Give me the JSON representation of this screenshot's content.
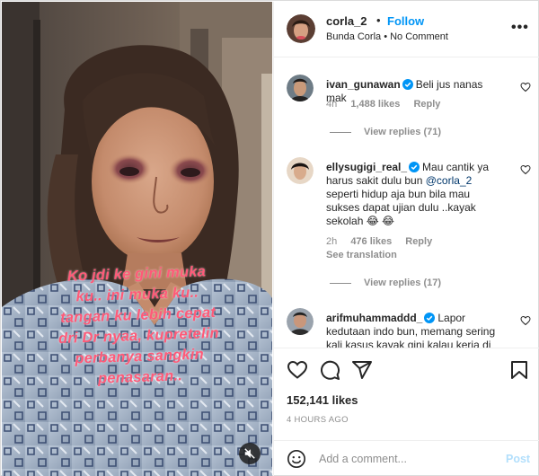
{
  "post": {
    "username": "corla_2",
    "separator": "•",
    "follow_label": "Follow",
    "subtitle": "Bunda Corla • No Comment",
    "more_label": "•••",
    "caption_lines": [
      "Ko jdi ke gini muka",
      "ku.. ini muka ku..",
      "tangan ku lebih cepat",
      "dri Dr nyaa, kupretelin",
      "perbanya sangkin",
      "penasaran.."
    ]
  },
  "comments": [
    {
      "username": "ivan_gunawan",
      "verified": true,
      "text": "Beli jus nanas mak",
      "age": "4h",
      "likes": "1,488 likes",
      "reply_label": "Reply",
      "view_replies": "View replies (71)"
    },
    {
      "username": "ellysugigi_real_",
      "verified": true,
      "text_before": "Mau cantik ya harus sakit dulu bun ",
      "mention": "@corla_2",
      "text_after": " seperti hidup aja bun bila mau sukses dapat ujian dulu ..kayak sekolah 😂 😂",
      "age": "2h",
      "likes": "476 likes",
      "reply_label": "Reply",
      "see_translation": "See translation",
      "view_replies": "View replies (17)"
    },
    {
      "username": "arifmuhammaddd_",
      "verified": true,
      "text": "Lapor kedutaan indo bun, memang sering kali kasus kayak gini kalau kerja di"
    }
  ],
  "actions": {
    "like_icon": "heart-icon",
    "comment_icon": "comment-icon",
    "share_icon": "share-icon",
    "save_icon": "bookmark-icon",
    "likes": "152,141 likes",
    "time_ago": "4 HOURS AGO"
  },
  "add_comment": {
    "emoji_icon": "smiley-icon",
    "placeholder": "Add a comment...",
    "post_label": "Post"
  },
  "colors": {
    "link_blue": "#0095f6",
    "verified_blue": "#0095f6",
    "caption_pink": "#ff5a78",
    "muted_gray": "#8e8e8e"
  }
}
